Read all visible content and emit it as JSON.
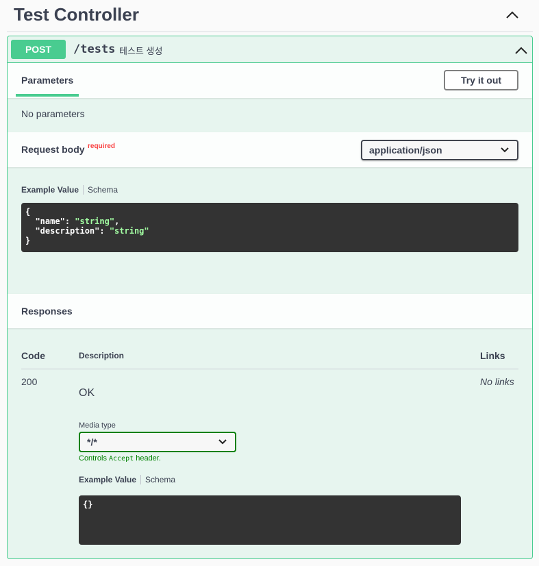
{
  "section": {
    "title": "Test Controller"
  },
  "operation": {
    "method": "POST",
    "path": "/tests",
    "summary": "테스트 생성",
    "colors": {
      "post": "#49cc90",
      "required": "#f93e3e",
      "code_bg": "#333333",
      "string": "#a2fca2"
    }
  },
  "parameters": {
    "tab_label": "Parameters",
    "try_button": "Try it out",
    "empty_text": "No parameters"
  },
  "request_body": {
    "title": "Request body",
    "required_label": "required",
    "content_type": "application/json",
    "example_tab": "Example Value",
    "schema_tab": "Schema",
    "example": {
      "open": "{",
      "lines": [
        {
          "key": "\"name\"",
          "sep": ": ",
          "value": "\"string\"",
          "tail": ","
        },
        {
          "key": "\"description\"",
          "sep": ": ",
          "value": "\"string\"",
          "tail": ""
        }
      ],
      "close": "}"
    }
  },
  "responses": {
    "title": "Responses",
    "columns": {
      "code": "Code",
      "description": "Description",
      "links": "Links"
    },
    "rows": [
      {
        "code": "200",
        "description": "OK",
        "links": "No links",
        "media_type_label": "Media type",
        "media_type": "*/*",
        "controls_prefix": "Controls ",
        "controls_code": "Accept",
        "controls_suffix": " header.",
        "example_tab": "Example Value",
        "schema_tab": "Schema",
        "example": "{}"
      }
    ]
  },
  "icons": [
    "chevron-up-icon",
    "chevron-down-icon"
  ]
}
